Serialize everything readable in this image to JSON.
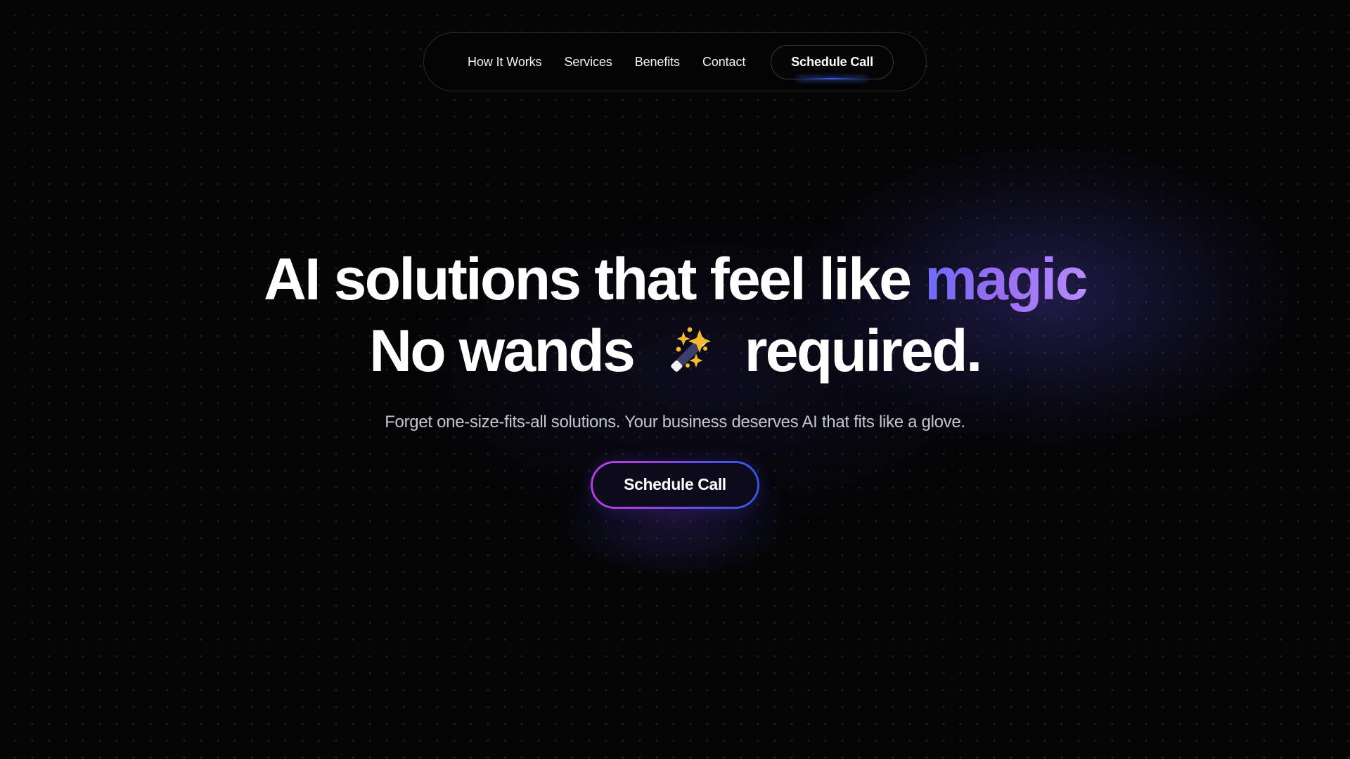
{
  "theme": {
    "background": "#050505",
    "dot_color": "#242424",
    "text_primary": "#ffffff",
    "text_muted": "#c2c6ce",
    "gradient_start": "#6d6cf8",
    "gradient_mid": "#9a6ef0",
    "gradient_end": "#b58cfb",
    "cta_border_left": "#c93fe8",
    "cta_border_right": "#2b5ce9",
    "cta_fill": "#0d0a1c",
    "nav_accent_glow": "#3c64f5"
  },
  "navbar": {
    "links": [
      {
        "label": "How It Works",
        "name": "nav-link-how-it-works"
      },
      {
        "label": "Services",
        "name": "nav-link-services"
      },
      {
        "label": "Benefits",
        "name": "nav-link-benefits"
      },
      {
        "label": "Contact",
        "name": "nav-link-contact"
      }
    ],
    "cta_label": "Schedule Call"
  },
  "hero": {
    "headline_line1_part1": "AI solutions that feel like ",
    "headline_line1_highlight": "magic",
    "headline_line2_part1": "No wands",
    "headline_line2_part2": "required.",
    "wand_icon": "magic-wand-emoji",
    "subtitle": "Forget one-size-fits-all solutions. Your business deserves AI that fits like a glove.",
    "cta_label": "Schedule Call"
  }
}
